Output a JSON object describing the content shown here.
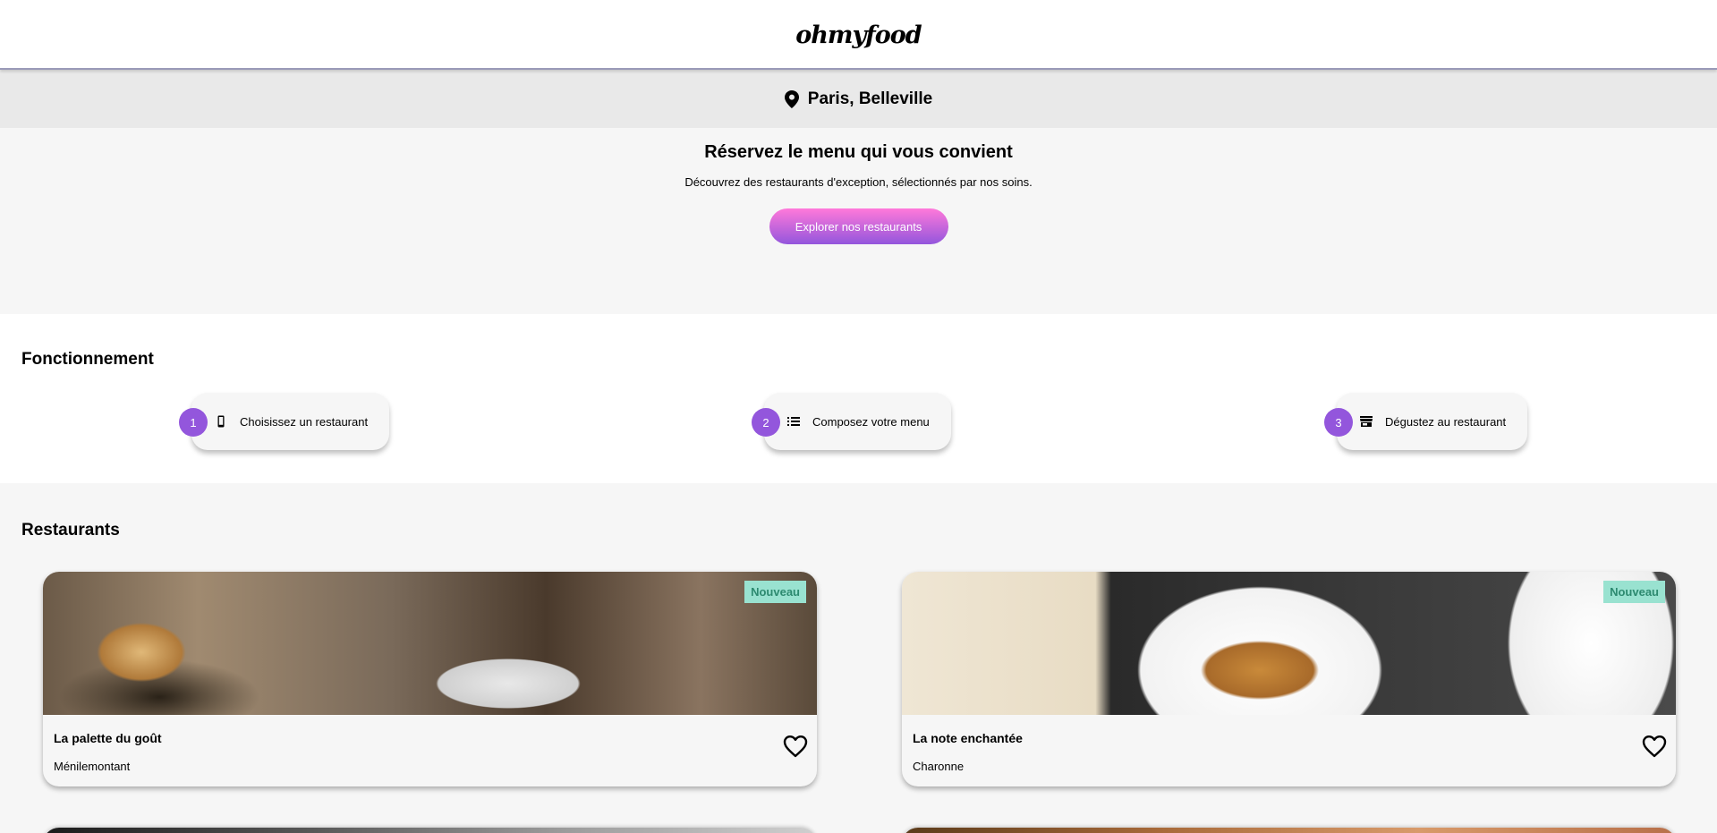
{
  "brand": {
    "logo": "ohmyfood"
  },
  "location": {
    "icon": "map-pin-icon",
    "label": "Paris, Belleville"
  },
  "hero": {
    "title": "Réservez le menu qui vous convient",
    "subtitle": "Découvrez des restaurants d'exception, sélectionnés par nos soins.",
    "cta_label": "Explorer nos restaurants"
  },
  "how": {
    "title": "Fonctionnement",
    "steps": [
      {
        "number": "1",
        "icon": "smartphone-icon",
        "label": "Choisissez un restaurant"
      },
      {
        "number": "2",
        "icon": "list-icon",
        "label": "Composez votre menu"
      },
      {
        "number": "3",
        "icon": "store-icon",
        "label": "Dégustez au restaurant"
      }
    ]
  },
  "restaurants": {
    "title": "Restaurants",
    "items": [
      {
        "name": "La palette du goût",
        "area": "Ménilemontant",
        "badge": "Nouveau",
        "favorite_icon": "heart-icon"
      },
      {
        "name": "La note enchantée",
        "area": "Charonne",
        "badge": "Nouveau",
        "favorite_icon": "heart-icon"
      }
    ]
  },
  "colors": {
    "accent_start": "#ff79da",
    "accent_end": "#9356dc",
    "badge_bg": "#99e2d0",
    "badge_text": "#2d8a70"
  }
}
